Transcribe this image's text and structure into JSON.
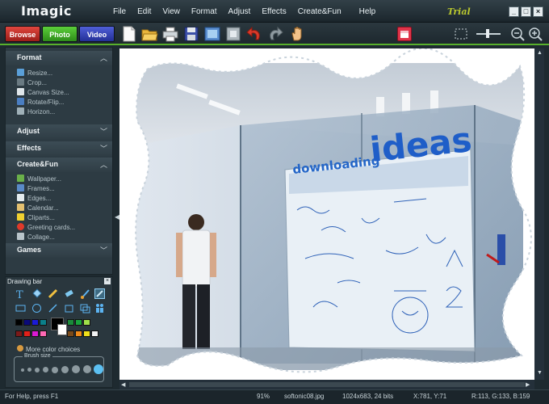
{
  "app": {
    "title": "Imagic",
    "trial_label": "Trial"
  },
  "menu": [
    "File",
    "Edit",
    "View",
    "Format",
    "Adjust",
    "Effects",
    "Create&Fun",
    "Help"
  ],
  "modes": {
    "browse": "Browse",
    "photo": "Photo",
    "video": "Video"
  },
  "panel": {
    "format": {
      "label": "Format",
      "items": [
        "Resize...",
        "Crop...",
        "Canvas Size...",
        "Rotate/Flip...",
        "Horizon..."
      ]
    },
    "adjust": {
      "label": "Adjust"
    },
    "effects": {
      "label": "Effects"
    },
    "createfun": {
      "label": "Create&Fun",
      "items": [
        "Wallpaper...",
        "Frames...",
        "Edges...",
        "Calendar...",
        "Cliparts...",
        "Greeting cards...",
        "Collage..."
      ]
    },
    "games": {
      "label": "Games"
    }
  },
  "drawing_bar": {
    "title": "Drawing bar",
    "more_colors": "More color choices",
    "brush_size_label": "Brush size",
    "colors_row1": [
      "#000000",
      "#0a0a7a",
      "#1b1bd6",
      "#ffffff",
      "#0b7f8a",
      "#1a8a3a",
      "#18a33c",
      "#9fe04a"
    ],
    "colors_row2": [
      "#7a1a1a",
      "#e0201a",
      "#d81ad4",
      "#ff69b4",
      "#7a4a1a",
      "#f08a1a",
      "#f0e01a",
      "#f2f2f2"
    ]
  },
  "image": {
    "headline_small": "downloading",
    "headline_big": "ideas"
  },
  "status": {
    "help": "For Help, press F1",
    "zoom": "91%",
    "filename": "softonic08.jpg",
    "dimensions": "1024x683, 24 bits",
    "coords": "X:781, Y:71",
    "rgb": "R:113, G:133, B:159"
  }
}
